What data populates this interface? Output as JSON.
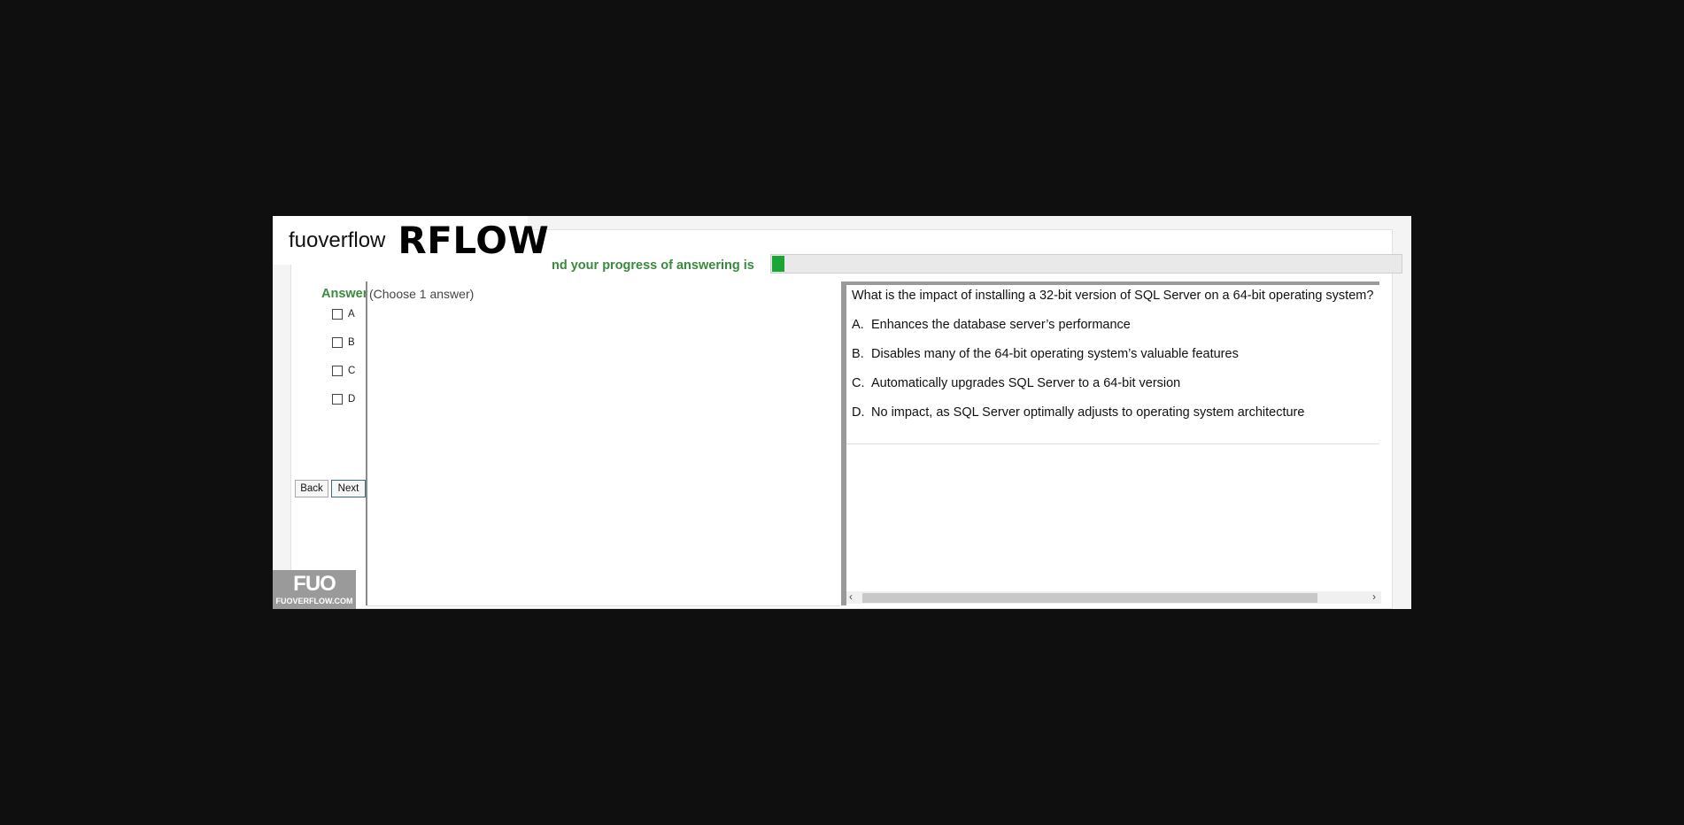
{
  "watermark": {
    "name": "fuoverflow",
    "big": "RFLOW",
    "logo": "FUO",
    "url": "FUOVERFLOW.COM"
  },
  "progress": {
    "label": "nd your progress of answering is",
    "fraction": 0.02,
    "fill_color": "#1aa636"
  },
  "answer_panel": {
    "heading": "Answer",
    "options": [
      "A",
      "B",
      "C",
      "D"
    ],
    "back_label": "Back",
    "next_label": "Next"
  },
  "instruction": "(Choose 1 answer)",
  "question": {
    "text": "What is the impact of installing a 32-bit version of SQL Server on a 64-bit operating system?",
    "options": [
      {
        "letter": "A.",
        "text": "Enhances the database server’s performance"
      },
      {
        "letter": "B.",
        "text": "Disables many of the 64-bit operating system’s valuable features"
      },
      {
        "letter": "C.",
        "text": "Automatically upgrades SQL Server to a 64-bit version"
      },
      {
        "letter": "D.",
        "text": "No impact, as SQL Server optimally adjusts to operating system architecture"
      }
    ]
  },
  "scrollbar": {
    "left_arrow": "‹",
    "right_arrow": "›"
  }
}
